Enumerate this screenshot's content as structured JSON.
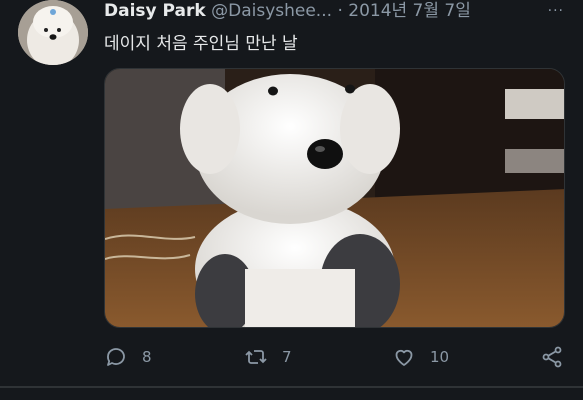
{
  "tweet": {
    "display_name": "Daisy Park",
    "handle": "@Daisyshee...",
    "separator": "·",
    "date": "2014년 7월 7일",
    "more_label": "···",
    "text": "데이지 처음 주인님 만난 날",
    "media": {
      "icon": "old-english-sheepdog-puppy-photo"
    },
    "actions": {
      "reply_count": "8",
      "retweet_count": "7",
      "like_count": "10"
    }
  },
  "colors": {
    "background": "#15181c",
    "text_primary": "#e7e9ea",
    "text_secondary": "#8b98a5",
    "border": "#2f3336"
  }
}
